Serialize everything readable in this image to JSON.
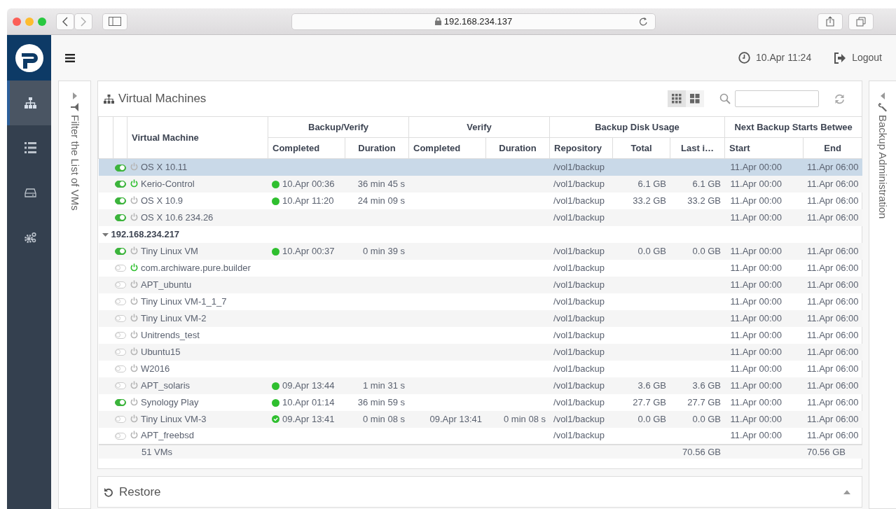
{
  "browser": {
    "url": "192.168.234.137"
  },
  "header": {
    "datetime": "10.Apr 11:24",
    "logout": "Logout"
  },
  "nav": [
    {
      "kind": "sitemap",
      "selected": true
    },
    {
      "kind": "list",
      "selected": false
    },
    {
      "kind": "drive",
      "selected": false
    },
    {
      "kind": "gears",
      "selected": false
    }
  ],
  "filter_panel": {
    "label": "Filter the List of VMs"
  },
  "vm_panel": {
    "title": "Virtual Machines",
    "view_modes": [
      {
        "kind": "list",
        "selected": true
      },
      {
        "kind": "tiles",
        "selected": false
      }
    ]
  },
  "table": {
    "name_column": "Virtual Machine",
    "column_groups": [
      {
        "label": "Backup/Verify",
        "columns": [
          "Completed",
          "Duration"
        ]
      },
      {
        "label": "Verify",
        "columns": [
          "Completed",
          "Duration"
        ]
      },
      {
        "label": "Backup Disk Usage",
        "columns": [
          "Repository",
          "Total",
          "Last i…"
        ]
      },
      {
        "label": "Next Backup Starts Betwee",
        "columns": [
          "Start",
          "End"
        ]
      }
    ],
    "groups": [
      {
        "rows": [
          {
            "name": "OS X 10.11",
            "enabled": true,
            "running": false,
            "selected": true,
            "repository": "/vol1/backup",
            "start": "11.Apr 00:00",
            "end": "11.Apr 06:00"
          },
          {
            "name": "Kerio-Control",
            "enabled": true,
            "running": true,
            "selected": false,
            "backup_verified": false,
            "backup_completed": "10.Apr 00:36",
            "backup_duration": "36 min 45 s",
            "repository": "/vol1/backup",
            "total": "6.1 GB",
            "last": "6.1 GB",
            "start": "11.Apr 00:00",
            "end": "11.Apr 06:00"
          },
          {
            "name": "OS X 10.9",
            "enabled": true,
            "running": false,
            "selected": false,
            "backup_verified": false,
            "backup_completed": "10.Apr 11:20",
            "backup_duration": "24 min 09 s",
            "repository": "/vol1/backup",
            "total": "33.2 GB",
            "last": "33.2 GB",
            "start": "11.Apr 00:00",
            "end": "11.Apr 06:00"
          },
          {
            "name": "OS X 10.6 234.26",
            "enabled": true,
            "running": false,
            "selected": false,
            "repository": "/vol1/backup",
            "start": "11.Apr 00:00",
            "end": "11.Apr 06:00"
          }
        ]
      },
      {
        "label": "192.168.234.217",
        "expanded": true,
        "rows": [
          {
            "name": "Tiny Linux VM",
            "enabled": true,
            "running": false,
            "selected": false,
            "backup_verified": false,
            "backup_completed": "10.Apr 00:37",
            "backup_duration": "0 min 39 s",
            "repository": "/vol1/backup",
            "total": "0.0 GB",
            "last": "0.0 GB",
            "start": "11.Apr 00:00",
            "end": "11.Apr 06:00"
          },
          {
            "name": "com.archiware.pure.builder",
            "enabled": false,
            "running": true,
            "selected": false,
            "repository": "/vol1/backup",
            "start": "11.Apr 00:00",
            "end": "11.Apr 06:00"
          },
          {
            "name": "APT_ubuntu",
            "enabled": false,
            "running": false,
            "selected": false,
            "repository": "/vol1/backup",
            "start": "11.Apr 00:00",
            "end": "11.Apr 06:00"
          },
          {
            "name": "Tiny Linux VM-1_1_7",
            "enabled": false,
            "running": false,
            "selected": false,
            "repository": "/vol1/backup",
            "start": "11.Apr 00:00",
            "end": "11.Apr 06:00"
          },
          {
            "name": "Tiny Linux VM-2",
            "enabled": false,
            "running": false,
            "selected": false,
            "repository": "/vol1/backup",
            "start": "11.Apr 00:00",
            "end": "11.Apr 06:00"
          },
          {
            "name": "Unitrends_test",
            "enabled": false,
            "running": false,
            "selected": false,
            "repository": "/vol1/backup",
            "start": "11.Apr 00:00",
            "end": "11.Apr 06:00"
          },
          {
            "name": "Ubuntu15",
            "enabled": false,
            "running": false,
            "selected": false,
            "repository": "/vol1/backup",
            "start": "11.Apr 00:00",
            "end": "11.Apr 06:00"
          },
          {
            "name": "W2016",
            "enabled": false,
            "running": false,
            "selected": false,
            "repository": "/vol1/backup",
            "start": "11.Apr 00:00",
            "end": "11.Apr 06:00"
          },
          {
            "name": "APT_solaris",
            "enabled": false,
            "running": false,
            "selected": false,
            "backup_verified": false,
            "backup_completed": "09.Apr 13:44",
            "backup_duration": "1 min 31 s",
            "repository": "/vol1/backup",
            "total": "3.6 GB",
            "last": "3.6 GB",
            "start": "11.Apr 00:00",
            "end": "11.Apr 06:00"
          },
          {
            "name": "Synology Play",
            "enabled": true,
            "running": false,
            "selected": false,
            "backup_verified": false,
            "backup_completed": "10.Apr 01:14",
            "backup_duration": "36 min 59 s",
            "repository": "/vol1/backup",
            "total": "27.7 GB",
            "last": "27.7 GB",
            "start": "11.Apr 00:00",
            "end": "11.Apr 06:00"
          },
          {
            "name": "Tiny Linux VM-3",
            "enabled": false,
            "running": false,
            "selected": false,
            "backup_verified": true,
            "backup_completed": "09.Apr 13:41",
            "backup_duration": "0 min 08 s",
            "verify_completed": "09.Apr 13:41",
            "verify_duration": "0 min 08 s",
            "repository": "/vol1/backup",
            "total": "0.0 GB",
            "last": "0.0 GB",
            "start": "11.Apr 00:00",
            "end": "11.Apr 06:00"
          },
          {
            "name": "APT_freebsd",
            "enabled": false,
            "running": false,
            "selected": false,
            "repository": "/vol1/backup",
            "start": "11.Apr 00:00",
            "end": "11.Apr 06:00"
          }
        ]
      }
    ],
    "footer": {
      "count": "51 VMs",
      "last_total": "70.56 GB",
      "end_total": "70.56 GB"
    }
  },
  "restore_panel": {
    "title": "Restore"
  },
  "admin_panel": {
    "label": "Backup Administration"
  }
}
